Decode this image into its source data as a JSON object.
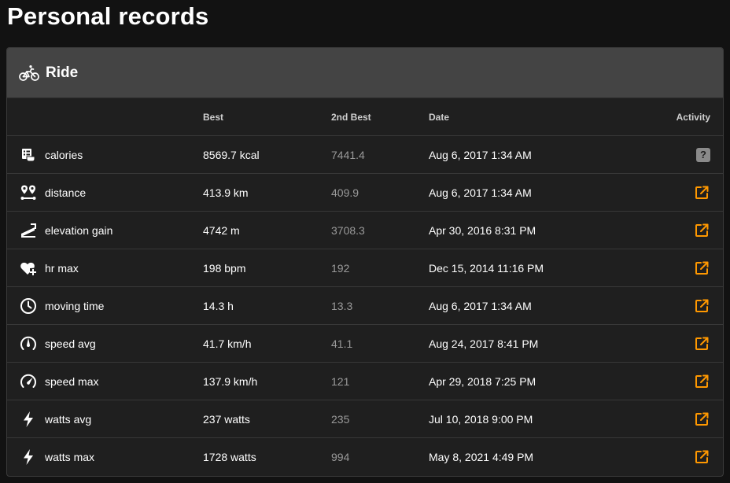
{
  "page": {
    "title": "Personal records"
  },
  "card": {
    "title": "Ride",
    "icon": "bicycle-icon"
  },
  "columns": {
    "metric": "",
    "best": "Best",
    "second": "2nd Best",
    "date": "Date",
    "activity": "Activity"
  },
  "rows": [
    {
      "icon": "calories-icon",
      "metric": "calories",
      "best": "8569.7 kcal",
      "second": "7441.4",
      "date": "Aug 6, 2017 1:34 AM",
      "activity": "unknown",
      "activity_symbol": "?"
    },
    {
      "icon": "distance-icon",
      "metric": "distance",
      "best": "413.9 km",
      "second": "409.9",
      "date": "Aug 6, 2017 1:34 AM",
      "activity": "link"
    },
    {
      "icon": "elevation-icon",
      "metric": "elevation gain",
      "best": "4742 m",
      "second": "3708.3",
      "date": "Apr 30, 2016 8:31 PM",
      "activity": "link"
    },
    {
      "icon": "heart-plus-icon",
      "metric": "hr max",
      "best": "198 bpm",
      "second": "192",
      "date": "Dec 15, 2014 11:16 PM",
      "activity": "link"
    },
    {
      "icon": "clock-icon",
      "metric": "moving time",
      "best": "14.3 h",
      "second": "13.3",
      "date": "Aug 6, 2017 1:34 AM",
      "activity": "link"
    },
    {
      "icon": "speedometer-slow-icon",
      "metric": "speed avg",
      "best": "41.7 km/h",
      "second": "41.1",
      "date": "Aug 24, 2017 8:41 PM",
      "activity": "link"
    },
    {
      "icon": "speedometer-fast-icon",
      "metric": "speed max",
      "best": "137.9 km/h",
      "second": "121",
      "date": "Apr 29, 2018 7:25 PM",
      "activity": "link"
    },
    {
      "icon": "lightning-icon",
      "metric": "watts avg",
      "best": "237 watts",
      "second": "235",
      "date": "Jul 10, 2018 9:00 PM",
      "activity": "link"
    },
    {
      "icon": "lightning-icon",
      "metric": "watts max",
      "best": "1728 watts",
      "second": "994",
      "date": "May 8, 2021 4:49 PM",
      "activity": "link"
    }
  ],
  "colors": {
    "background": "#121212",
    "card": "#1f1f1f",
    "header": "#444444",
    "accent": "#ff9800",
    "muted": "#9a9a9a"
  }
}
